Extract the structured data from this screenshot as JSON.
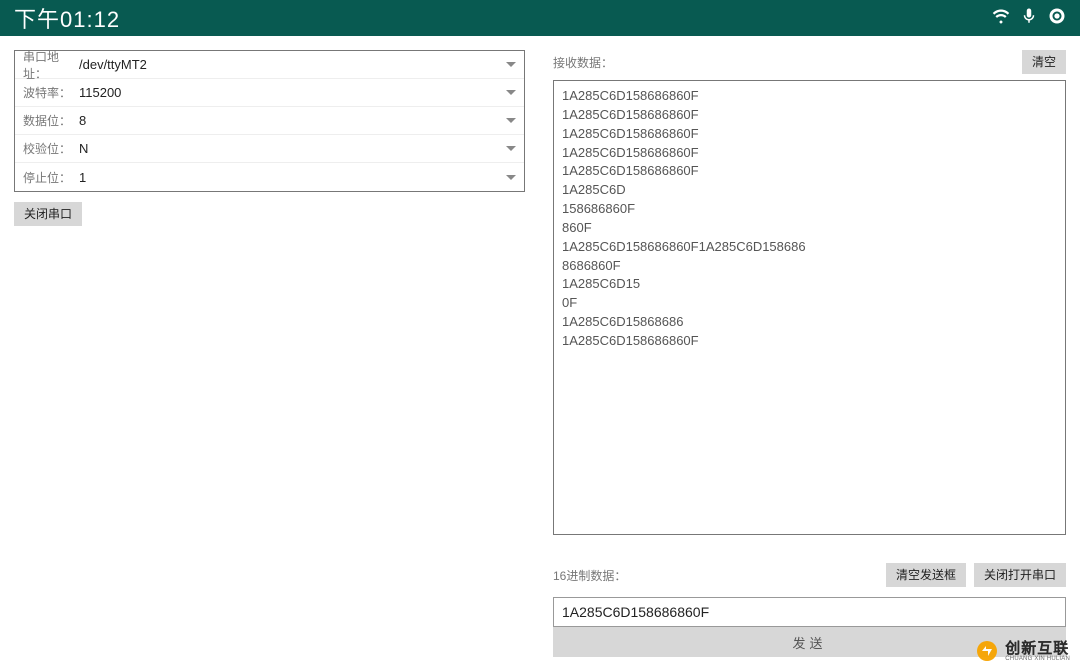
{
  "status_bar": {
    "time": "下午01:12",
    "icons": [
      "wifi-icon",
      "mic-icon",
      "camera-icon"
    ]
  },
  "config": {
    "port_address_label": "串口地址：",
    "port_address_value": "/dev/ttyMT2",
    "baud_label": "波特率：",
    "baud_value": "115200",
    "data_bits_label": "数据位：",
    "data_bits_value": "8",
    "parity_label": "校验位：",
    "parity_value": "N",
    "stop_bits_label": "停止位：",
    "stop_bits_value": "1"
  },
  "buttons": {
    "close_port": "关闭串口",
    "clear_recv": "清空",
    "clear_send": "清空发送框",
    "toggle_port": "关闭打开串口",
    "send": "发送"
  },
  "recv": {
    "label": "接收数据：",
    "lines": [
      "1A285C6D158686860F",
      "1A285C6D158686860F",
      "1A285C6D158686860F",
      "1A285C6D158686860F",
      "1A285C6D158686860F",
      "1A285C6D",
      "158686860F",
      "860F",
      "1A285C6D158686860F1A285C6D158686",
      "8686860F",
      "1A285C6D15",
      "0F",
      "1A285C6D15868686",
      "1A285C6D158686860F"
    ]
  },
  "send": {
    "label": "16进制数据：",
    "value": "1A285C6D158686860F"
  },
  "watermark": {
    "cn": "创新互联",
    "en": "CHUANG XIN HULIAN"
  }
}
